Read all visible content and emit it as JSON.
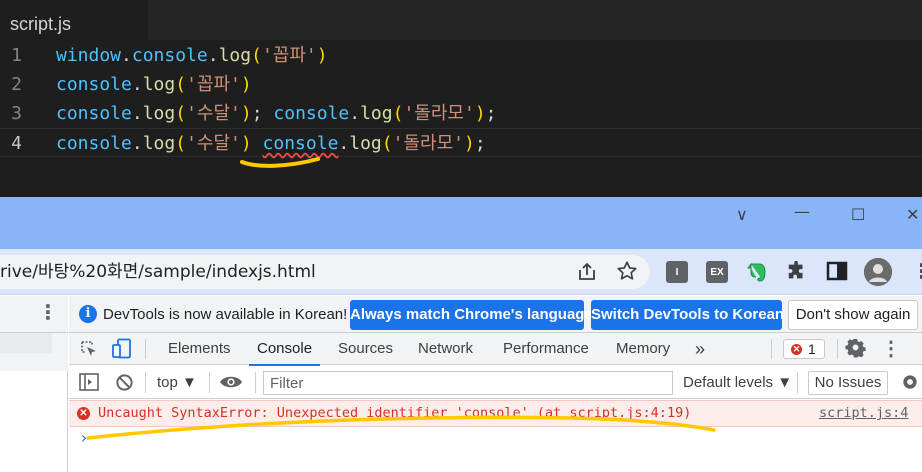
{
  "editor": {
    "filename": "script.js",
    "lines": [
      {
        "num": "1",
        "tokens": [
          {
            "t": "window",
            "c": "t-obj"
          },
          {
            "t": ".",
            "c": "t-dot"
          },
          {
            "t": "console",
            "c": "t-obj"
          },
          {
            "t": ".",
            "c": "t-dot"
          },
          {
            "t": "log",
            "c": "t-fn"
          },
          {
            "t": "(",
            "c": "t-p"
          },
          {
            "t": "'꼽파'",
            "c": "t-str"
          },
          {
            "t": ")",
            "c": "t-p"
          }
        ]
      },
      {
        "num": "2",
        "tokens": [
          {
            "t": "console",
            "c": "t-obj"
          },
          {
            "t": ".",
            "c": "t-dot"
          },
          {
            "t": "log",
            "c": "t-fn"
          },
          {
            "t": "(",
            "c": "t-p"
          },
          {
            "t": "'꼽파'",
            "c": "t-str"
          },
          {
            "t": ")",
            "c": "t-p"
          }
        ]
      },
      {
        "num": "3",
        "tokens": [
          {
            "t": "console",
            "c": "t-obj"
          },
          {
            "t": ".",
            "c": "t-dot"
          },
          {
            "t": "log",
            "c": "t-fn"
          },
          {
            "t": "(",
            "c": "t-p"
          },
          {
            "t": "'수달'",
            "c": "t-str"
          },
          {
            "t": ")",
            "c": "t-p"
          },
          {
            "t": "; ",
            "c": "t-dot"
          },
          {
            "t": "console",
            "c": "t-obj"
          },
          {
            "t": ".",
            "c": "t-dot"
          },
          {
            "t": "log",
            "c": "t-fn"
          },
          {
            "t": "(",
            "c": "t-p"
          },
          {
            "t": "'돌라모'",
            "c": "t-str"
          },
          {
            "t": ")",
            "c": "t-p"
          },
          {
            "t": ";",
            "c": "t-dot"
          }
        ]
      },
      {
        "num": "4",
        "active": true,
        "tokens": [
          {
            "t": "console",
            "c": "t-obj"
          },
          {
            "t": ".",
            "c": "t-dot"
          },
          {
            "t": "log",
            "c": "t-fn"
          },
          {
            "t": "(",
            "c": "t-p"
          },
          {
            "t": "'수달'",
            "c": "t-str"
          },
          {
            "t": ")",
            "c": "t-p"
          },
          {
            "t": " ",
            "c": "t-dot"
          },
          {
            "t": "console",
            "c": "t-obj squiggle"
          },
          {
            "t": ".",
            "c": "t-dot"
          },
          {
            "t": "log",
            "c": "t-fn"
          },
          {
            "t": "(",
            "c": "t-p"
          },
          {
            "t": "'돌라모'",
            "c": "t-str"
          },
          {
            "t": ")",
            "c": "t-p"
          },
          {
            "t": ";",
            "c": "t-dot"
          }
        ]
      }
    ]
  },
  "window_controls": {
    "chevron": "∨",
    "minimize": "—",
    "maximize": "☐",
    "close": "✕"
  },
  "omnibar": {
    "url": "rive/바탕%20화면/sample/indexjs.html",
    "extensions": {
      "ext1": "I",
      "ext2": "EX"
    }
  },
  "devtools": {
    "info_text": "DevTools is now available in Korean!",
    "btn_match": "Always match Chrome's language",
    "btn_switch": "Switch DevTools to Korean",
    "btn_dont_show": "Don't show again",
    "tabs": {
      "elements": "Elements",
      "console": "Console",
      "sources": "Sources",
      "network": "Network",
      "performance": "Performance",
      "memory": "Memory",
      "more": "»"
    },
    "error_count": "1",
    "context": "top ▼",
    "filter_placeholder": "Filter",
    "levels": "Default levels ▼",
    "issues": "No Issues",
    "error_message": "Uncaught SyntaxError: Unexpected identifier 'console' (at script.js:4:19)",
    "error_source": "script.js:4",
    "prompt": "›"
  },
  "colors": {
    "accent": "#1a73e8",
    "error": "#d93025",
    "titlebar": "#8ab4f8",
    "marker": "#ffc800"
  }
}
